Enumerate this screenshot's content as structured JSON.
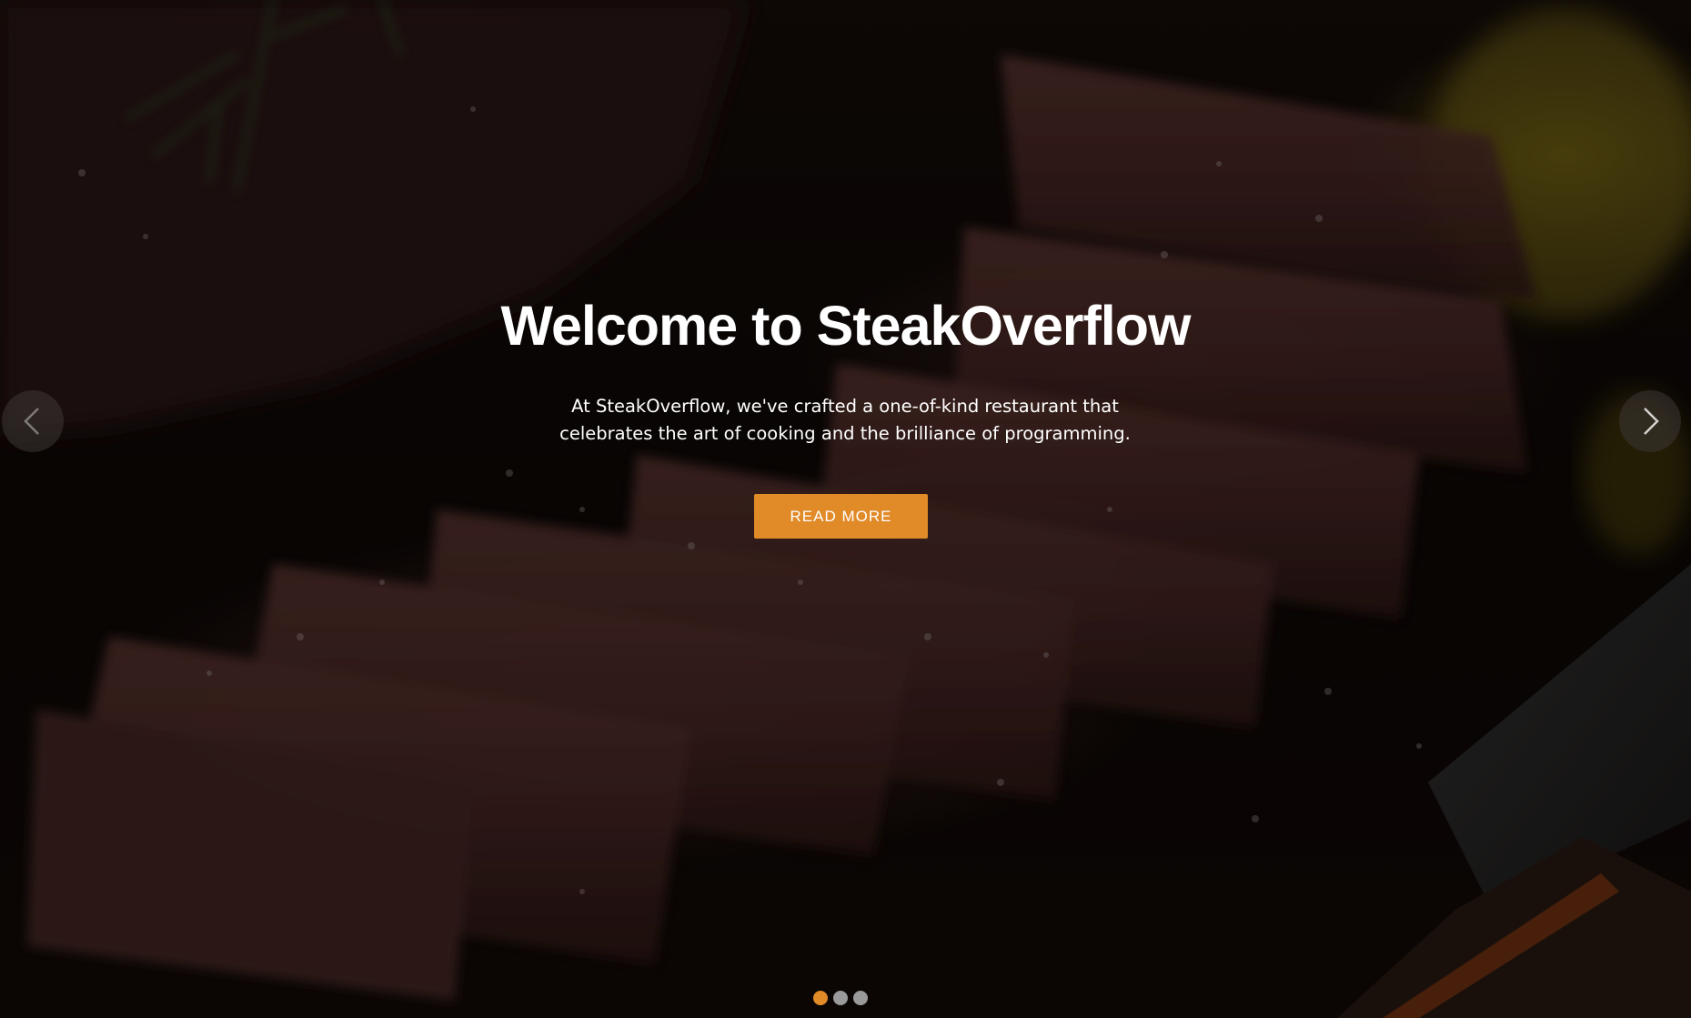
{
  "hero": {
    "title": "Welcome to SteakOverflow",
    "subtitle": "At SteakOverflow, we've crafted a one-of-kind restaurant that celebrates the art of cooking and the brilliance of programming.",
    "cta_label": "READ MORE",
    "prev_icon": "chevron-left-icon",
    "next_icon": "chevron-right-icon"
  },
  "carousel": {
    "slide_count": 3,
    "active_slide": 1
  },
  "colors": {
    "accent": "#e08a28",
    "inactive_dot": "#9a9a9a",
    "text": "#ffffff"
  }
}
